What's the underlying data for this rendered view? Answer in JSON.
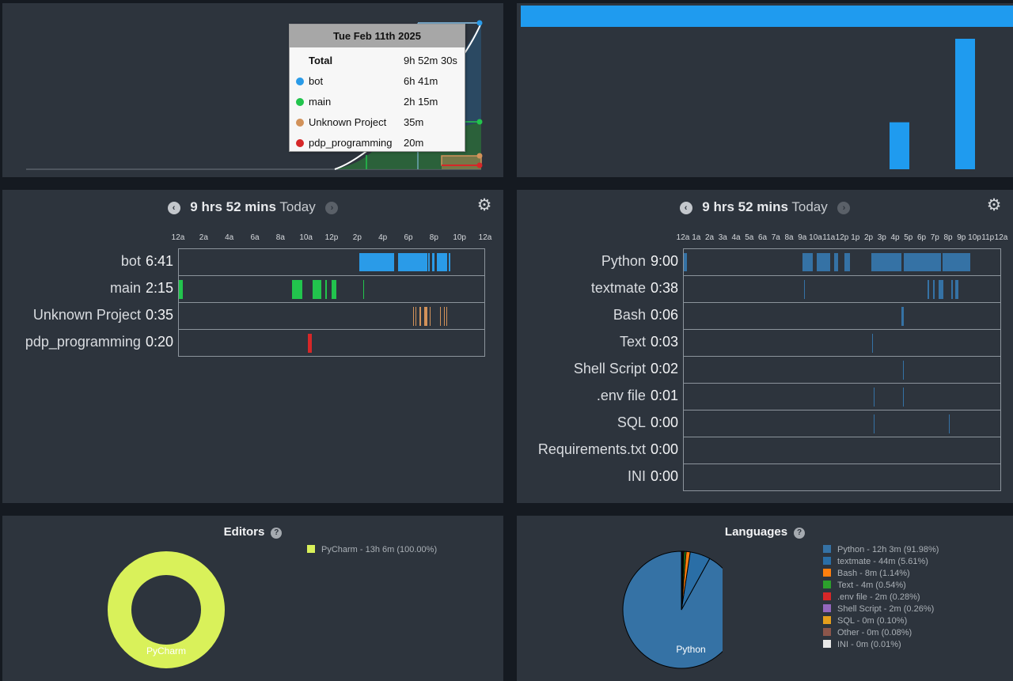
{
  "colors": {
    "panel": "#2d343d",
    "bot": "#2a9be8",
    "main": "#22c44d",
    "unknown": "#d2925a",
    "pdp": "#d62728",
    "editor": "#d9f15a",
    "python_lang": "#3572a5"
  },
  "area_chart": {
    "tooltip": {
      "date": "Tue Feb 11th 2025",
      "total_label": "Total",
      "total_value": "9h 52m 30s",
      "rows": [
        {
          "name": "bot",
          "value": "6h 41m",
          "color": "#2a9be8"
        },
        {
          "name": "main",
          "value": "2h 15m",
          "color": "#22c44d"
        },
        {
          "name": "Unknown Project",
          "value": "35m",
          "color": "#d2925a"
        },
        {
          "name": "pdp_programming",
          "value": "20m",
          "color": "#d62728"
        }
      ]
    }
  },
  "bar_chart": {
    "values": [
      0.36,
      1.0
    ]
  },
  "projects_timeline": {
    "total": "9 hrs 52 mins",
    "day": "Today",
    "prev_icon": "chevron-left-icon",
    "next_icon": "chevron-right-icon",
    "settings_icon": "gear-icon",
    "hours": [
      "12a",
      "2a",
      "4a",
      "6a",
      "8a",
      "10a",
      "12p",
      "2p",
      "4p",
      "6p",
      "8p",
      "10p",
      "12a"
    ],
    "rows": [
      {
        "name": "bot",
        "time": "6:41",
        "color": "#2a9be8",
        "segments": [
          [
            14.2,
            16.9
          ],
          [
            17.2,
            19.5
          ],
          [
            19.6,
            19.7
          ],
          [
            19.9,
            20.1
          ],
          [
            20.3,
            21.1
          ],
          [
            21.2,
            21.3
          ]
        ]
      },
      {
        "name": "main",
        "time": "2:15",
        "color": "#22c44d",
        "segments": [
          [
            0,
            0.3
          ],
          [
            8.9,
            9.7
          ],
          [
            10.5,
            11.2
          ],
          [
            11.5,
            11.6
          ],
          [
            12.0,
            12.4
          ],
          [
            14.5,
            14.55
          ]
        ]
      },
      {
        "name": "Unknown Project",
        "time": "0:35",
        "color": "#d2925a",
        "segments": [
          [
            18.4,
            18.45
          ],
          [
            18.6,
            18.65
          ],
          [
            18.9,
            19.0
          ],
          [
            19.3,
            19.55
          ],
          [
            19.7,
            19.8
          ],
          [
            20.5,
            20.55
          ],
          [
            20.8,
            20.85
          ],
          [
            21.0,
            21.05
          ]
        ]
      },
      {
        "name": "pdp_programming",
        "time": "0:20",
        "color": "#d62728",
        "segments": [
          [
            10.15,
            10.45
          ]
        ]
      }
    ]
  },
  "languages_timeline": {
    "total": "9 hrs 52 mins",
    "day": "Today",
    "hours": [
      "12a",
      "1a",
      "2a",
      "3a",
      "4a",
      "5a",
      "6a",
      "7a",
      "8a",
      "9a",
      "10a",
      "11a",
      "12p",
      "1p",
      "2p",
      "3p",
      "4p",
      "5p",
      "6p",
      "7p",
      "8p",
      "9p",
      "10p",
      "11p",
      "12a"
    ],
    "rows": [
      {
        "name": "Python",
        "time": "9:00",
        "segments": [
          [
            0,
            0.25
          ],
          [
            9.0,
            9.8
          ],
          [
            10.1,
            11.1
          ],
          [
            11.4,
            11.7
          ],
          [
            12.2,
            12.6
          ],
          [
            14.2,
            16.5
          ],
          [
            16.7,
            19.5
          ],
          [
            19.6,
            21.7
          ]
        ]
      },
      {
        "name": "textmate",
        "time": "0:38",
        "segments": [
          [
            9.1,
            9.2
          ],
          [
            18.5,
            18.6
          ],
          [
            18.9,
            19.0
          ],
          [
            19.3,
            19.7
          ],
          [
            20.3,
            20.4
          ],
          [
            20.6,
            20.8
          ]
        ]
      },
      {
        "name": "Bash",
        "time": "0:06",
        "segments": [
          [
            16.5,
            16.7
          ]
        ]
      },
      {
        "name": "Text",
        "time": "0:03",
        "segments": [
          [
            14.25,
            14.35
          ]
        ]
      },
      {
        "name": "Shell Script",
        "time": "0:02",
        "segments": [
          [
            16.6,
            16.7
          ]
        ]
      },
      {
        "name": ".env file",
        "time": "0:01",
        "segments": [
          [
            14.4,
            14.45
          ],
          [
            16.6,
            16.65
          ]
        ]
      },
      {
        "name": "SQL",
        "time": "0:00",
        "segments": [
          [
            14.4,
            14.45
          ],
          [
            20.1,
            20.15
          ]
        ]
      },
      {
        "name": "Requirements.txt",
        "time": "0:00",
        "segments": []
      },
      {
        "name": "INI",
        "time": "0:00",
        "segments": []
      }
    ]
  },
  "editors": {
    "title": "Editors",
    "help_icon": "question-circle-icon",
    "legend": [
      {
        "label": "PyCharm - 13h 6m (100.00%)",
        "color": "#d9f15a"
      }
    ],
    "donut_label": "PyCharm"
  },
  "languages": {
    "title": "Languages",
    "help_icon": "question-circle-icon",
    "pie_label": "Python",
    "legend": [
      {
        "label": "Python - 12h 3m (91.98%)",
        "color": "#3572a5",
        "pct": 91.98
      },
      {
        "label": "textmate - 44m (5.61%)",
        "color": "#2a6ea6",
        "pct": 5.61
      },
      {
        "label": "Bash - 8m (1.14%)",
        "color": "#ff7f0e",
        "pct": 1.14
      },
      {
        "label": "Text - 4m (0.54%)",
        "color": "#2ca02c",
        "pct": 0.54
      },
      {
        "label": ".env file - 2m (0.28%)",
        "color": "#d62728",
        "pct": 0.28
      },
      {
        "label": "Shell Script - 2m (0.26%)",
        "color": "#9467bd",
        "pct": 0.26
      },
      {
        "label": "SQL - 0m (0.10%)",
        "color": "#e59e1c",
        "pct": 0.1
      },
      {
        "label": "Other - 0m (0.08%)",
        "color": "#8c564b",
        "pct": 0.08
      },
      {
        "label": "INI - 0m (0.01%)",
        "color": "#e8e8e8",
        "pct": 0.01
      }
    ]
  }
}
